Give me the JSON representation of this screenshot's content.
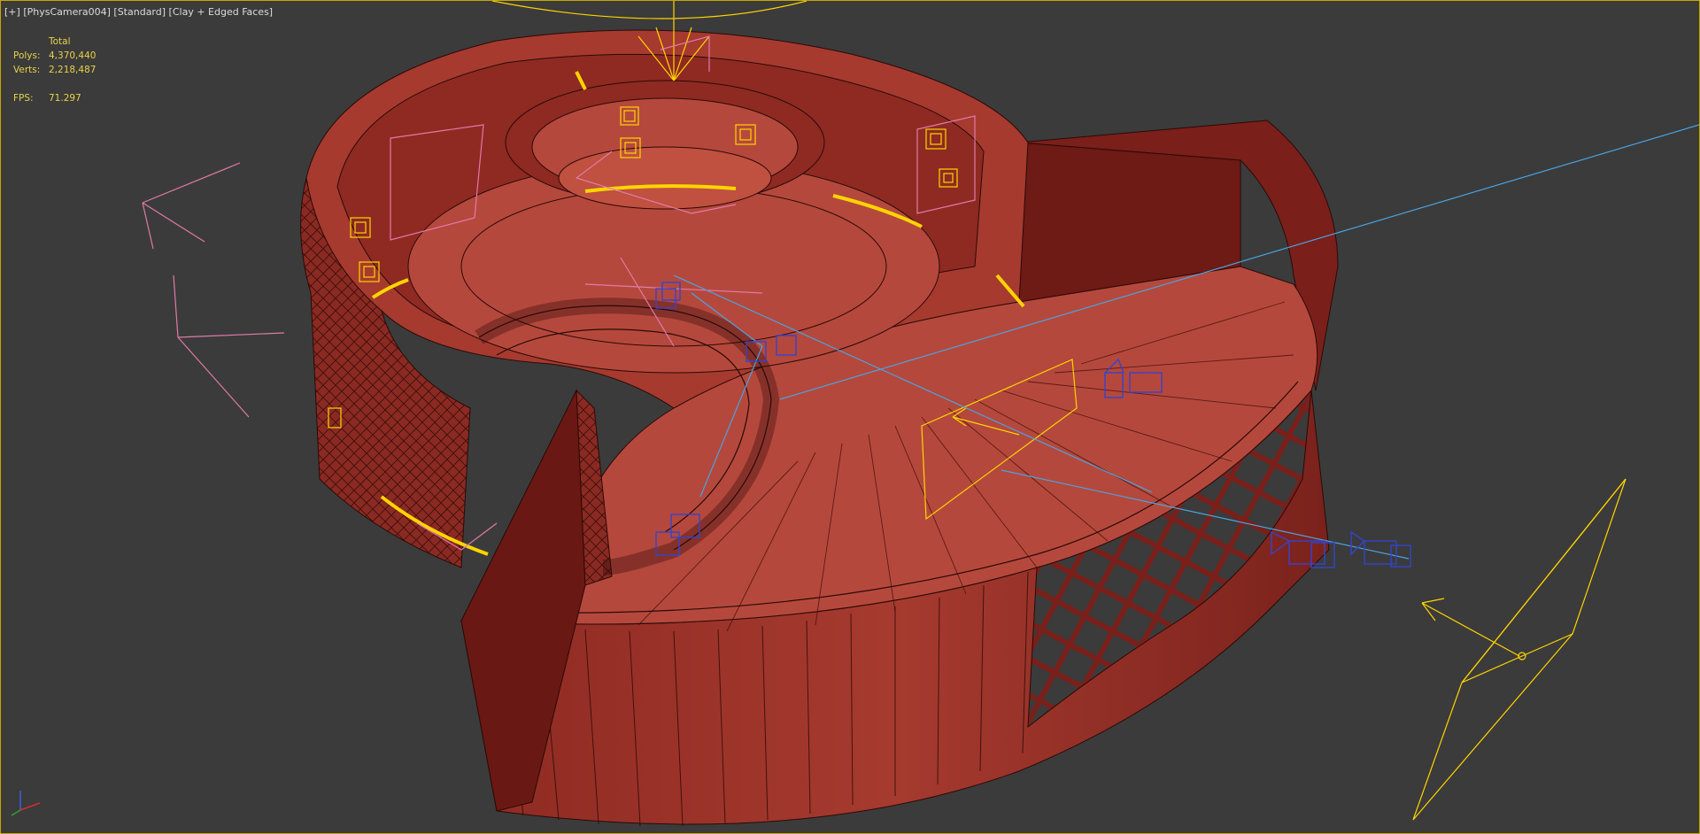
{
  "viewport": {
    "label_plus": "[+]",
    "label_camera": "[PhysCamera004]",
    "label_shading_mode": "[Standard]",
    "label_display": "[Clay + Edged Faces]"
  },
  "stats": {
    "header": "Total",
    "polys_label": "Polys:",
    "polys_value": "4,370,440",
    "verts_label": "Verts:",
    "verts_value": "2,218,487",
    "fps_label": "FPS:",
    "fps_value": "71.297"
  },
  "colors": {
    "background": "#3b3b3b",
    "viewport_border": "#c8a800",
    "clay": "#b84a3e",
    "clay_dark": "#7a1f1a",
    "clay_shadow": "#5a1410",
    "edge": "#2a0a08",
    "light_gizmo": "#ffd400",
    "camera_gizmo": "#3344cc",
    "target_line": "#4aa3e0",
    "helper_pink": "#e07aa8",
    "stats_text": "#e8d24a"
  },
  "icons": {
    "axis_tripod": "axis-tripod-icon",
    "camera": "camera-gizmo-icon",
    "light": "light-gizmo-icon"
  }
}
